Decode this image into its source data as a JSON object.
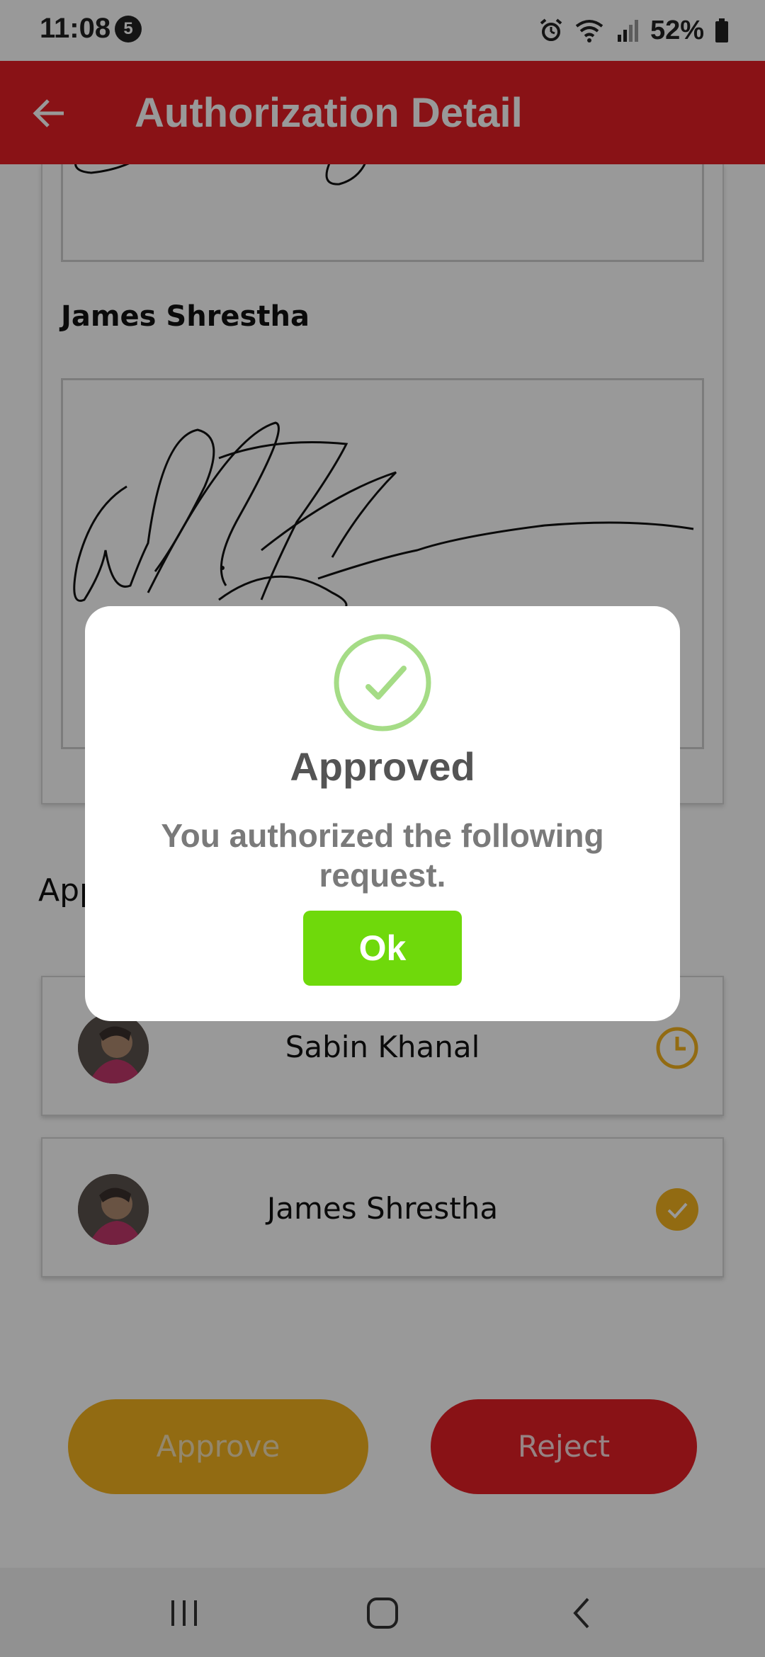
{
  "status_bar": {
    "time": "11:08",
    "notification_count": "5",
    "battery": "52%"
  },
  "app_bar": {
    "title": "Authorization Detail",
    "back_icon": "arrow-left-icon",
    "color": "#e41f26"
  },
  "signatures": {
    "signer_name": "James Shrestha"
  },
  "approvals": {
    "label": "App",
    "approvers": [
      {
        "name": "Sabin Khanal",
        "status_icon": "clock-icon",
        "status": "pending"
      },
      {
        "name": "James Shrestha",
        "status_icon": "check-circle-icon",
        "status": "approved"
      }
    ],
    "status_color": "#f3b21f"
  },
  "actions": {
    "approve_label": "Approve",
    "reject_label": "Reject"
  },
  "dialog": {
    "title": "Approved",
    "message": "You authorized the following request.",
    "ok_label": "Ok",
    "ok_color": "#6fd90b",
    "icon": "check-circle-icon",
    "icon_color": "#a5dc86"
  },
  "nav_bar": {
    "icons": [
      "recent-apps-icon",
      "home-icon",
      "back-icon"
    ]
  }
}
